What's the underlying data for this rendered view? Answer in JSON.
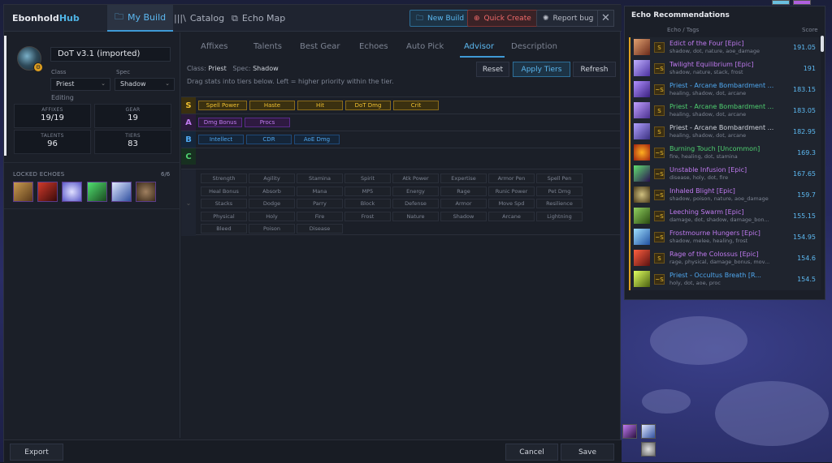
{
  "app": {
    "logo_main": "Ebonhold",
    "logo_accent": "Hub"
  },
  "nav": [
    {
      "label": "My Build",
      "icon": "folder-icon",
      "active": true
    },
    {
      "label": "Catalog",
      "icon": "library-icon"
    },
    {
      "label": "Echo Map",
      "icon": "external-link-icon"
    }
  ],
  "top_actions": {
    "new_build": "New Build",
    "quick_create": "Quick Create",
    "report_bug": "Report bug",
    "close": "✕"
  },
  "build": {
    "name": "DoT v3.1 (imported)",
    "class_label": "Class",
    "class_value": "Priest",
    "spec_label": "Spec",
    "spec_value": "Shadow",
    "status": "Editing",
    "stats": [
      {
        "label": "AFFIXES",
        "value": "19/19"
      },
      {
        "label": "GEAR",
        "value": "19"
      },
      {
        "label": "TALENTS",
        "value": "96"
      },
      {
        "label": "TIERS",
        "value": "83"
      }
    ],
    "locked_echoes_label": "LOCKED ECHOES",
    "locked_echoes_count": "6/6"
  },
  "tabs": [
    "Affixes",
    "Talents",
    "Best Gear",
    "Echoes",
    "Auto Pick",
    "Advisor",
    "Description"
  ],
  "active_tab": "Advisor",
  "advisor": {
    "class_label": "Class:",
    "class_value": "Priest",
    "spec_label": "Spec:",
    "spec_value": "Shadow",
    "hint": "Drag stats into tiers below. Left = higher priority within the tier.",
    "reset": "Reset",
    "apply": "Apply Tiers",
    "refresh": "Refresh",
    "tiers": [
      {
        "label": "S",
        "color": "#f0c030",
        "stats": [
          "Spell Power",
          "Haste",
          "Hit",
          "DoT Dmg",
          "Crit"
        ]
      },
      {
        "label": "A",
        "color": "#c07af0",
        "stats": [
          "Dmg Bonus",
          "Procs"
        ]
      },
      {
        "label": "B",
        "color": "#4fa8f0",
        "stats": [
          "Intellect",
          "CDR",
          "AoE Dmg"
        ]
      },
      {
        "label": "C",
        "color": "#4fd070",
        "stats": []
      }
    ],
    "pool_label": "⌄",
    "pool": [
      "Strength",
      "Agility",
      "Stamina",
      "Spirit",
      "Atk Power",
      "Expertise",
      "Armor Pen",
      "Spell Pen",
      "Heal Bonus",
      "Absorb",
      "Mana",
      "MP5",
      "Energy",
      "Rage",
      "Runic Power",
      "Pet Dmg",
      "Stacks",
      "Dodge",
      "Parry",
      "Block",
      "Defense",
      "Armor",
      "Move Spd",
      "Resilience",
      "Physical",
      "Holy",
      "Fire",
      "Frost",
      "Nature",
      "Shadow",
      "Arcane",
      "Lightning",
      "Bleed",
      "Poison",
      "Disease"
    ]
  },
  "footer": {
    "export": "Export",
    "cancel": "Cancel",
    "save": "Save"
  },
  "echo_recs": {
    "title": "Echo Recommendations",
    "col_echo": "Echo / Tags",
    "col_score": "Score",
    "rows": [
      {
        "name": "Edict of the Four [Epic]",
        "tags": "shadow, dot, nature, aoe_damage",
        "score": "191.05",
        "rank": "S",
        "color": "#c07af0",
        "border": "#e0a020"
      },
      {
        "name": "Twilight Equilibrium [Epic]",
        "tags": "shadow, nature, stack, frost",
        "score": "191",
        "rank": "~S",
        "color": "#c07af0",
        "border": "#e0a020"
      },
      {
        "name": "Priest - Arcane Bombardment ...",
        "tags": "healing, shadow, dot, arcane",
        "score": "183.15",
        "rank": "~S",
        "color": "#4fa8f0",
        "border": "#e0a020"
      },
      {
        "name": "Priest - Arcane Bombardment ...",
        "tags": "healing, shadow, dot, arcane",
        "score": "183.05",
        "rank": "S",
        "color": "#4fd070",
        "border": "#e0a020"
      },
      {
        "name": "Priest - Arcane Bombardment ...",
        "tags": "healing, shadow, dot, arcane",
        "score": "182.95",
        "rank": "S",
        "color": "#d0d4dc",
        "border": "#e0a020"
      },
      {
        "name": "Burning Touch [Uncommon]",
        "tags": "fire, healing, dot, stamina",
        "score": "169.3",
        "rank": "~S",
        "color": "#4fd070",
        "border": "#e0a020"
      },
      {
        "name": "Unstable Infusion [Epic]",
        "tags": "disease, holy, dot, fire",
        "score": "167.65",
        "rank": "~S",
        "color": "#c07af0",
        "border": "#e0a020"
      },
      {
        "name": "Inhaled Blight [Epic]",
        "tags": "shadow, poison, nature, aoe_damage",
        "score": "159.7",
        "rank": "~S",
        "color": "#c07af0",
        "border": "#e0a020"
      },
      {
        "name": "Leeching Swarm [Epic]",
        "tags": "damage, dot, shadow, damage_bon...",
        "score": "155.15",
        "rank": "~S",
        "color": "#c07af0",
        "border": "#e0a020"
      },
      {
        "name": "Frostmourne Hungers [Epic]",
        "tags": "shadow, melee, healing, frost",
        "score": "154.95",
        "rank": "~S",
        "color": "#c07af0",
        "border": "#e0a020"
      },
      {
        "name": "Rage of the Colossus [Epic]",
        "tags": "rage, physical, damage_bonus, mov...",
        "score": "154.6",
        "rank": "S",
        "color": "#c07af0",
        "border": "#e0a020"
      },
      {
        "name": "Priest - Occultus Breath [R...",
        "tags": "holy, dot, aoe, proc",
        "score": "154.5",
        "rank": "~S",
        "color": "#4fa8f0",
        "border": "#e0a020"
      }
    ]
  }
}
